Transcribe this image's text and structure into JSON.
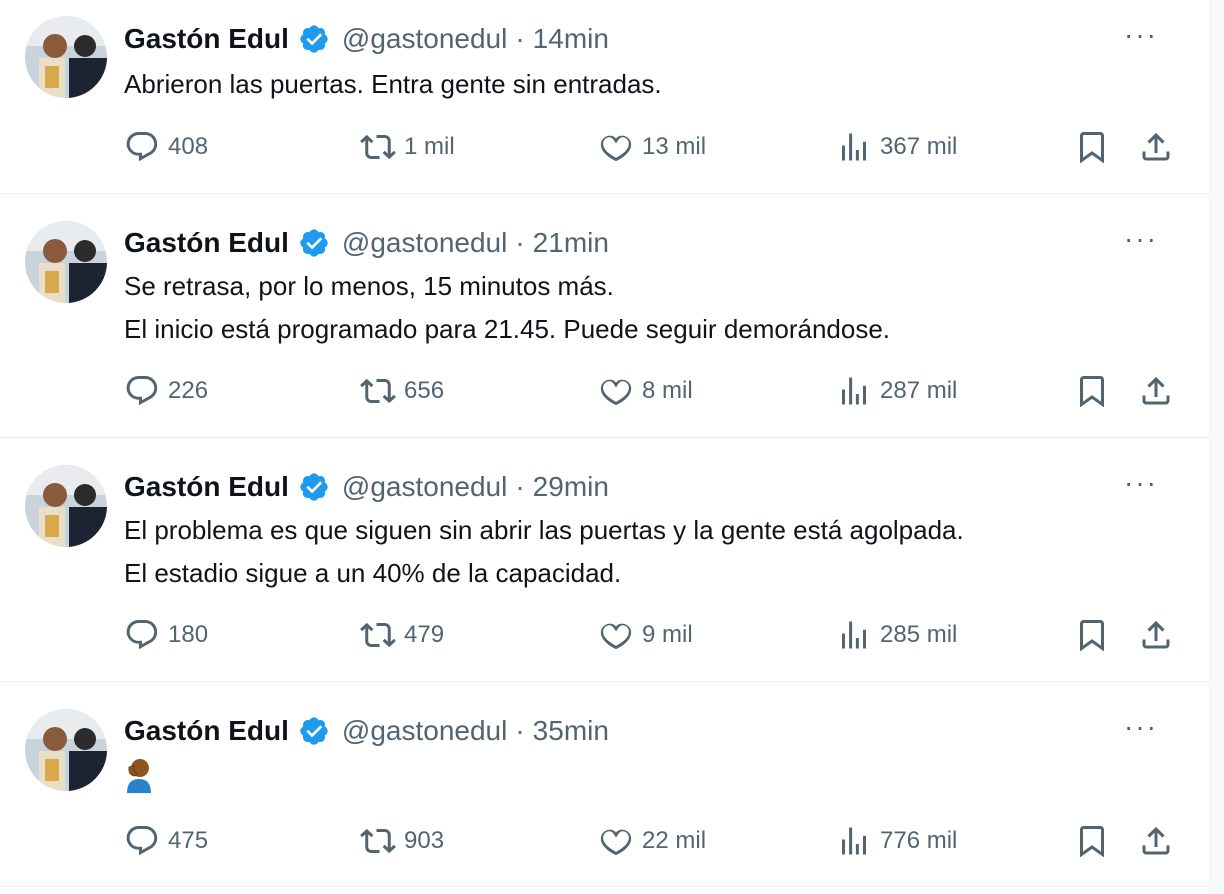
{
  "tweets": [
    {
      "author": "Gastón Edul",
      "handle": "@gastonedul",
      "separator": "·",
      "time": "14min",
      "more": "···",
      "lines": [
        "Abrieron las puertas. Entra gente sin entradas."
      ],
      "emoji": "",
      "replies": "408",
      "retweets": "1 mil",
      "likes": "13 mil",
      "views": "367 mil"
    },
    {
      "author": "Gastón Edul",
      "handle": "@gastonedul",
      "separator": "·",
      "time": "21min",
      "more": "···",
      "lines": [
        "Se retrasa, por lo menos, 15 minutos más.",
        "El inicio está programado para 21.45. Puede seguir demorándose."
      ],
      "emoji": "",
      "replies": "226",
      "retweets": "656",
      "likes": "8 mil",
      "views": "287 mil"
    },
    {
      "author": "Gastón Edul",
      "handle": "@gastonedul",
      "separator": "·",
      "time": "29min",
      "more": "···",
      "lines": [
        "El problema es que siguen sin abrir las puertas y la gente está agolpada.",
        "El estadio sigue a un 40% de la capacidad."
      ],
      "emoji": "",
      "replies": "180",
      "retweets": "479",
      "likes": "9 mil",
      "views": "285 mil"
    },
    {
      "author": "Gastón Edul",
      "handle": "@gastonedul",
      "separator": "·",
      "time": "35min",
      "more": "···",
      "lines": [],
      "emoji": "person-facepalming",
      "replies": "475",
      "retweets": "903",
      "likes": "22 mil",
      "views": "776 mil"
    }
  ],
  "colors": {
    "text": "#0f1419",
    "secondary": "#536471",
    "verified": "#1d9bf0",
    "divider": "#e6ecf0"
  },
  "icons": [
    "reply-icon",
    "retweet-icon",
    "like-icon",
    "views-icon",
    "bookmark-icon",
    "share-icon",
    "verified-badge-icon",
    "more-icon"
  ]
}
